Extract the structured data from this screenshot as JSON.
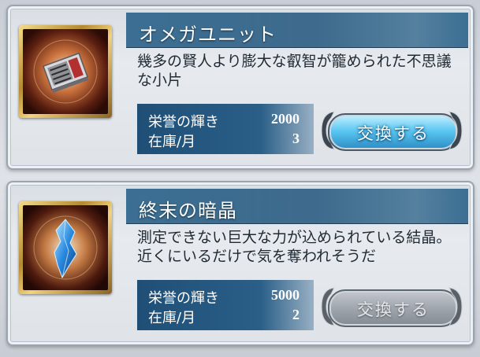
{
  "items": [
    {
      "name": "オメガユニット",
      "description": "幾多の賢人より膨大な叡智が籠められた不思議な小片",
      "cost_label": "栄誉の輝き",
      "cost_value": "2000",
      "stock_label": "在庫/月",
      "stock_value": "3",
      "button_label": "交換する",
      "button_state": "enabled",
      "icon": "omega-unit-icon"
    },
    {
      "name": "終末の暗晶",
      "description": "測定できない巨大な力が込められている結晶。近くにいるだけで気を奪われそうだ",
      "cost_label": "栄誉の輝き",
      "cost_value": "5000",
      "stock_label": "在庫/月",
      "stock_value": "2",
      "button_label": "交換する",
      "button_state": "disabled",
      "icon": "dark-crystal-icon"
    }
  ],
  "colors": {
    "title_bar": "#2f5f84",
    "button_active": "#5dc8f2",
    "button_disabled": "#9da3aa",
    "frame_gold": "#d4ad55"
  }
}
